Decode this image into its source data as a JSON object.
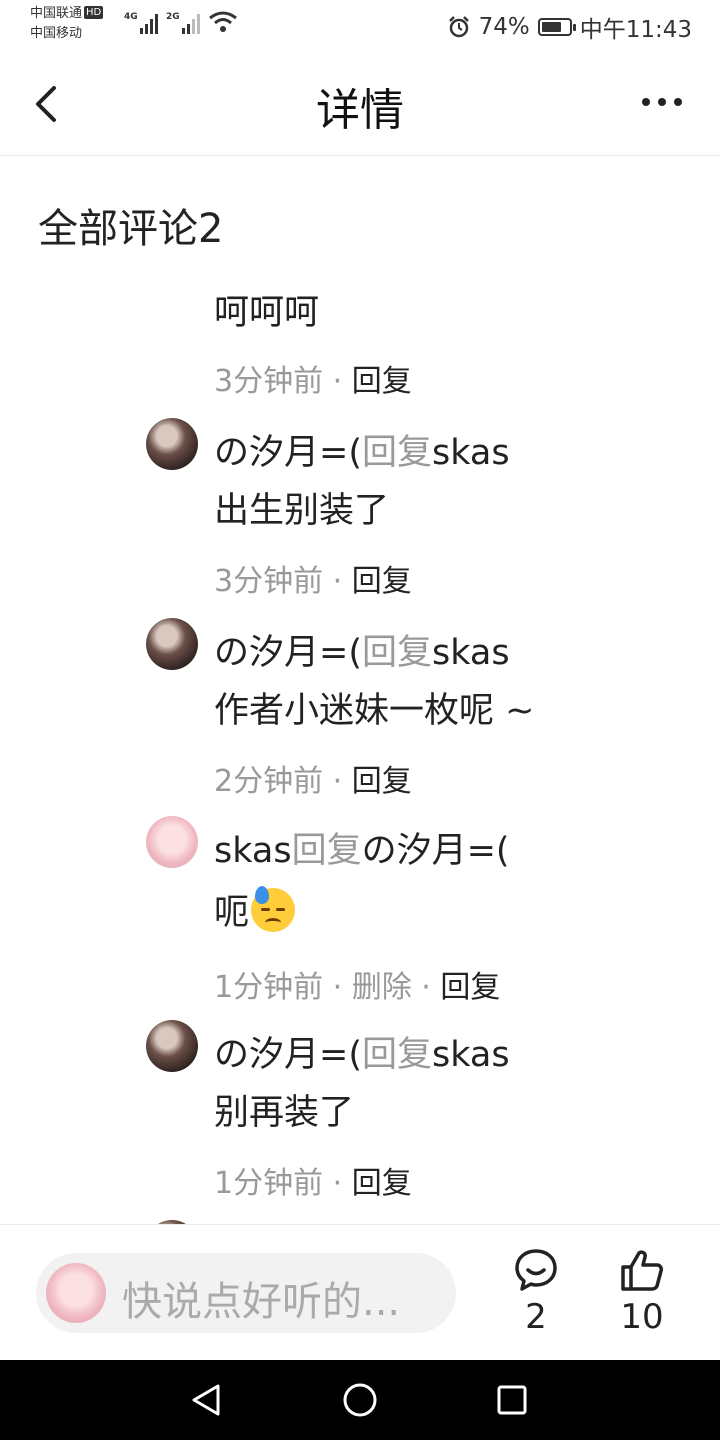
{
  "status_bar": {
    "carrier1": "中国联通",
    "hd_badge": "HD",
    "carrier2": "中国移动",
    "signal1_label": "4G",
    "signal2_label": "2G",
    "battery_percent": "74%",
    "battery_level": 0.74,
    "time": "中午11:43"
  },
  "header": {
    "title": "详情"
  },
  "section_title": "全部评论2",
  "comments": [
    {
      "text": "呵呵呵",
      "time": "3分钟前",
      "sep": "·",
      "reply": "回复"
    },
    {
      "author": "の汐月=(",
      "reply_word": "回复",
      "target": "skas",
      "text": "出生别装了",
      "time": "3分钟前",
      "sep": "·",
      "reply": "回复"
    },
    {
      "author": "の汐月=(",
      "reply_word": "回复",
      "target": "skas",
      "text": "作者小迷妹一枚呢 ~",
      "time": "2分钟前",
      "sep": "·",
      "reply": "回复"
    },
    {
      "author": "skas",
      "reply_word": "回复",
      "target": "の汐月=(",
      "text": "呃",
      "emoji": "sweat-face",
      "time": "1分钟前",
      "sep": "·",
      "delete": "删除",
      "sep2": "·",
      "reply": "回复"
    },
    {
      "author": "の汐月=(",
      "reply_word": "回复",
      "target": "skas",
      "text": "别再装了",
      "time": "1分钟前",
      "sep": "·",
      "reply": "回复"
    }
  ],
  "bottom_bar": {
    "placeholder": "快说点好听的...",
    "comment_count": "2",
    "like_count": "10"
  }
}
